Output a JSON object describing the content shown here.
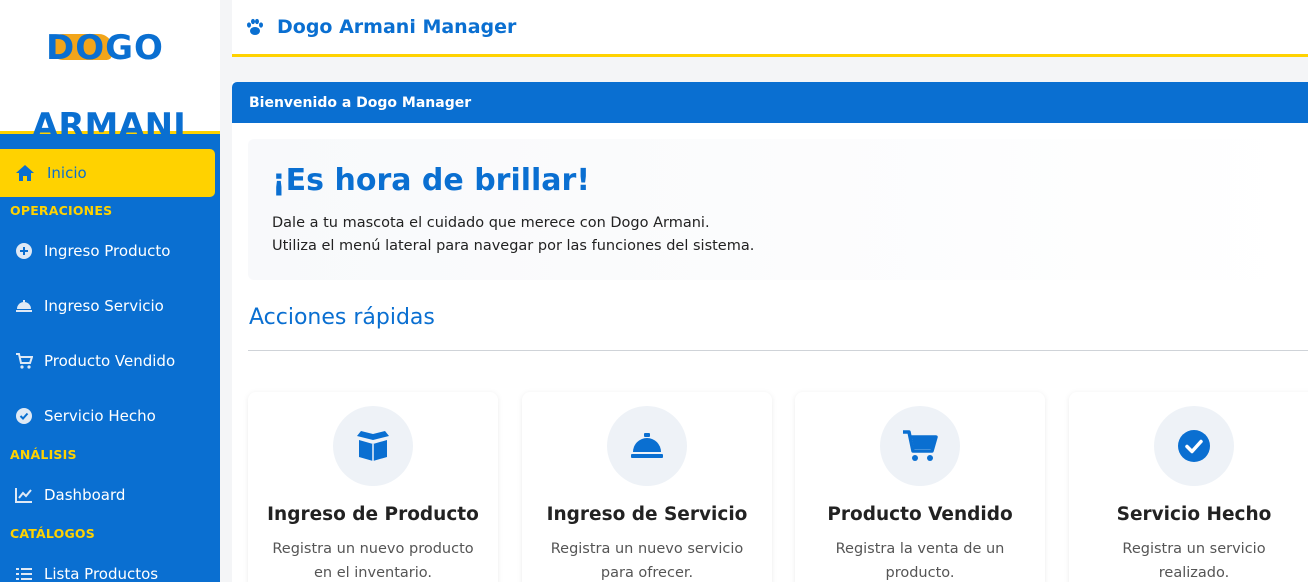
{
  "app": {
    "title": "Dogo Armani Manager"
  },
  "logo": {
    "line1": "DOGO",
    "line2": "ARMANI"
  },
  "sidebar": {
    "home": "Inicio",
    "sections": [
      "OPERACIONES",
      "ANÁLISIS",
      "CATÁLOGOS"
    ],
    "items": [
      {
        "label": "Ingreso Producto",
        "icon": "plus-circle-icon"
      },
      {
        "label": "Ingreso Servicio",
        "icon": "service-bell-icon"
      },
      {
        "label": "Producto Vendido",
        "icon": "cart-icon"
      },
      {
        "label": "Servicio Hecho",
        "icon": "check-circle-icon"
      },
      {
        "label": "Dashboard",
        "icon": "line-chart-icon"
      },
      {
        "label": "Lista Productos",
        "icon": "list-icon"
      }
    ]
  },
  "card": {
    "header": "Bienvenido a Dogo Manager"
  },
  "hero": {
    "title": "¡Es hora de brillar!",
    "line1": "Dale a tu mascota el cuidado que merece con Dogo Armani.",
    "line2": "Utiliza el menú lateral para navegar por las funciones del sistema."
  },
  "quick_actions": {
    "title": "Acciones rápidas",
    "cards": [
      {
        "name": "Ingreso de Producto",
        "desc": "Registra un nuevo producto en el inventario.",
        "icon": "box-icon"
      },
      {
        "name": "Ingreso de Servicio",
        "desc": "Registra un nuevo servicio para ofrecer.",
        "icon": "service-bell-icon"
      },
      {
        "name": "Producto Vendido",
        "desc": "Registra la venta de un producto.",
        "icon": "cart-icon"
      },
      {
        "name": "Servicio Hecho",
        "desc": "Registra un servicio realizado.",
        "icon": "check-circle-icon"
      }
    ]
  },
  "colors": {
    "primary": "#0a6fd1",
    "accent": "#ffd200",
    "logo_orange": "#f2a51a"
  }
}
